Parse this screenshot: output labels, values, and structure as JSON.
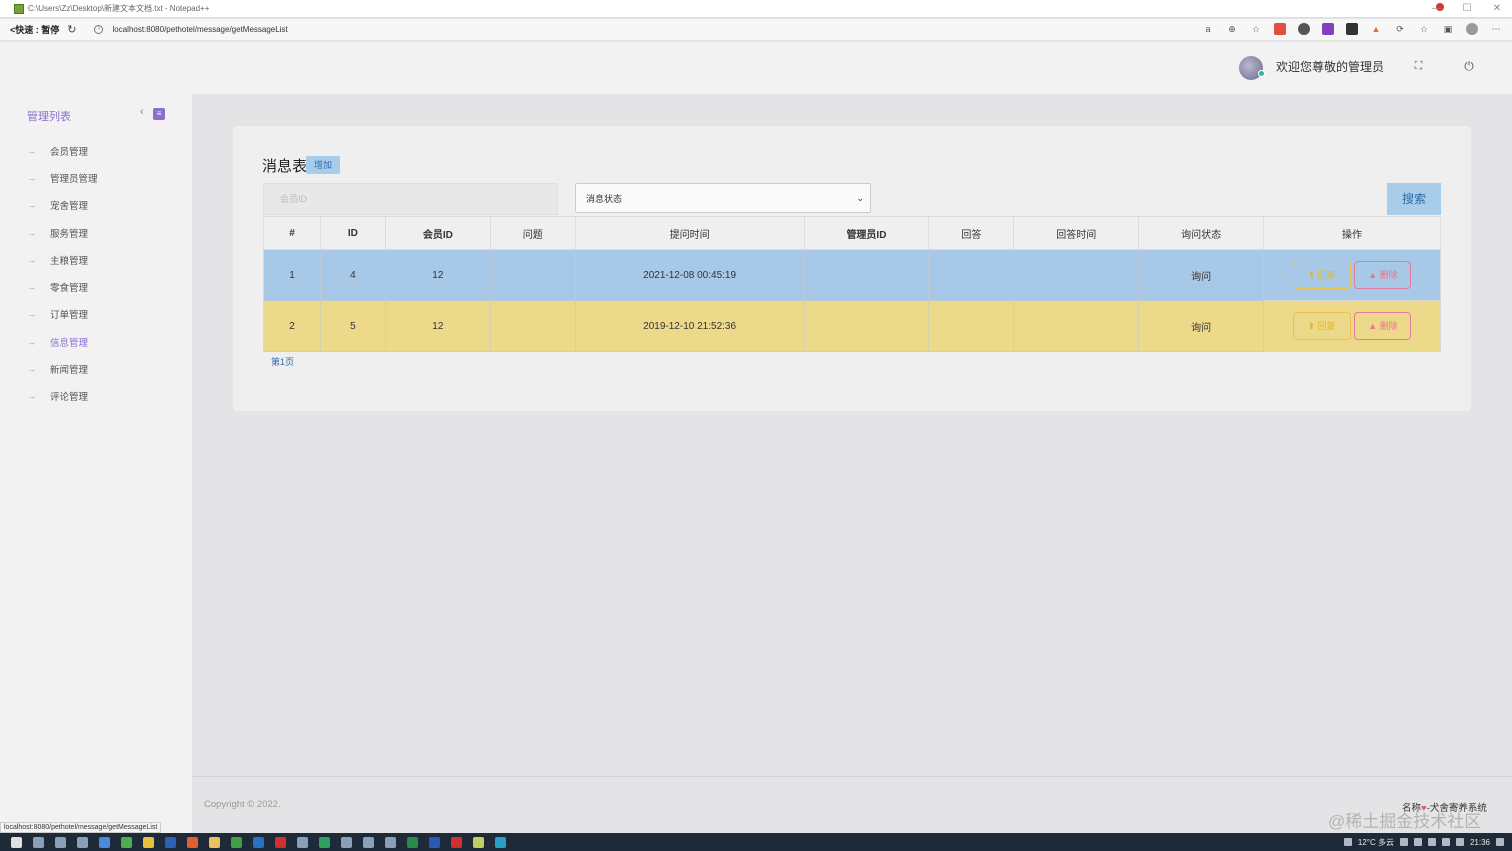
{
  "window": {
    "title": "C:\\Users\\Zz\\Desktop\\新建文本文档.txt - Notepad++",
    "controls": [
      "—",
      "☐",
      "✕"
    ]
  },
  "browser": {
    "back_label": "<快速 : 暂停",
    "url": "localhost:8080/pethotel/message/getMessageList",
    "status_url": "localhost:8080/pethotel/message/getMessageList"
  },
  "header": {
    "welcome": "欢迎您尊敬的管理员"
  },
  "sidebar": {
    "title": "管理列表",
    "items": [
      {
        "label": "会员管理",
        "active": false
      },
      {
        "label": "管理员管理",
        "active": false
      },
      {
        "label": "宠舍管理",
        "active": false
      },
      {
        "label": "服务管理",
        "active": false
      },
      {
        "label": "主粮管理",
        "active": false
      },
      {
        "label": "零食管理",
        "active": false
      },
      {
        "label": "订单管理",
        "active": false
      },
      {
        "label": "信息管理",
        "active": true
      },
      {
        "label": "新闻管理",
        "active": false
      },
      {
        "label": "评论管理",
        "active": false
      }
    ]
  },
  "main": {
    "title": "消息表",
    "add_label": "增加",
    "member_id_placeholder": "会员ID",
    "status_select_value": "消息状态",
    "search_label": "搜索",
    "pager": "第1页",
    "columns": [
      "#",
      "ID",
      "会员ID",
      "问题",
      "提问时间",
      "管理员ID",
      "回答",
      "回答时间",
      "询问状态",
      "操作"
    ],
    "rows": [
      {
        "index": "1",
        "id": "4",
        "member_id": "12",
        "question": "",
        "ask_time": "2021-12-08 00:45:19",
        "admin_id": "",
        "answer": "",
        "answer_time": "",
        "status": "询问",
        "reply_label": "回复",
        "delete_label": "删除"
      },
      {
        "index": "2",
        "id": "5",
        "member_id": "12",
        "question": "",
        "ask_time": "2019-12-10 21:52:36",
        "admin_id": "",
        "answer": "",
        "answer_time": "",
        "status": "询问",
        "reply_label": "回复",
        "delete_label": "删除"
      }
    ]
  },
  "footer": {
    "copyright": "Copyright © 2022.",
    "brand_prefix": "名称",
    "brand_name": "-犬舍寄养系统",
    "watermark": "@稀土掘金技术社区"
  },
  "taskbar": {
    "weather": "12°C 多云",
    "clock": "21:36"
  },
  "colors": {
    "accent_purple": "#8a6fd1",
    "row_blue": "#a8c8e8",
    "row_yellow": "#edd98a",
    "button_blue": "#a8cdea",
    "reply_yellow": "#e5b52a",
    "delete_pink": "#e8758e"
  }
}
